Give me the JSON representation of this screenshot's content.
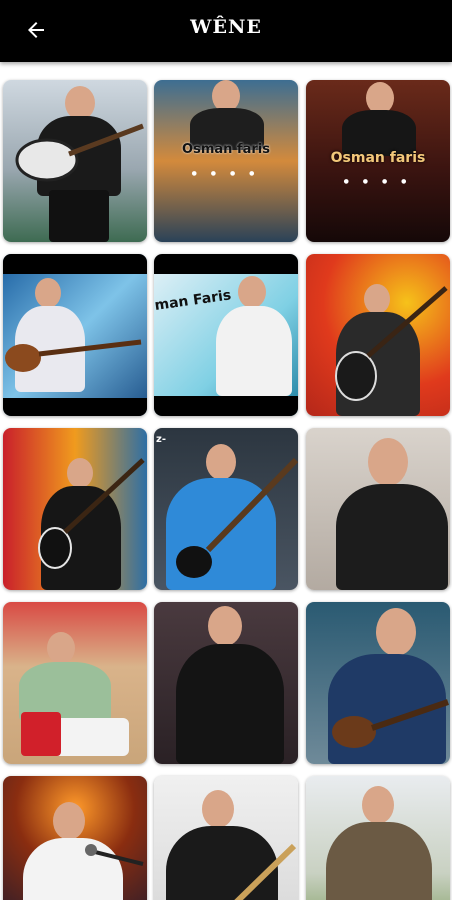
{
  "appbar": {
    "title": "WÊNE",
    "back_icon": "arrow-left-icon",
    "background": "#000000"
  },
  "tiles": [
    {
      "id": 1,
      "caption": ""
    },
    {
      "id": 2,
      "caption": "Osman faris"
    },
    {
      "id": 3,
      "caption": "Osman faris"
    },
    {
      "id": 4,
      "caption": ""
    },
    {
      "id": 5,
      "caption": "man Faris"
    },
    {
      "id": 6,
      "caption": ""
    },
    {
      "id": 7,
      "caption": ""
    },
    {
      "id": 8,
      "caption": "z-"
    },
    {
      "id": 9,
      "caption": ""
    },
    {
      "id": 10,
      "caption": ""
    },
    {
      "id": 11,
      "caption": ""
    },
    {
      "id": 12,
      "caption": ""
    },
    {
      "id": 13,
      "caption": ""
    },
    {
      "id": 14,
      "caption": ""
    },
    {
      "id": 15,
      "caption": ""
    }
  ]
}
